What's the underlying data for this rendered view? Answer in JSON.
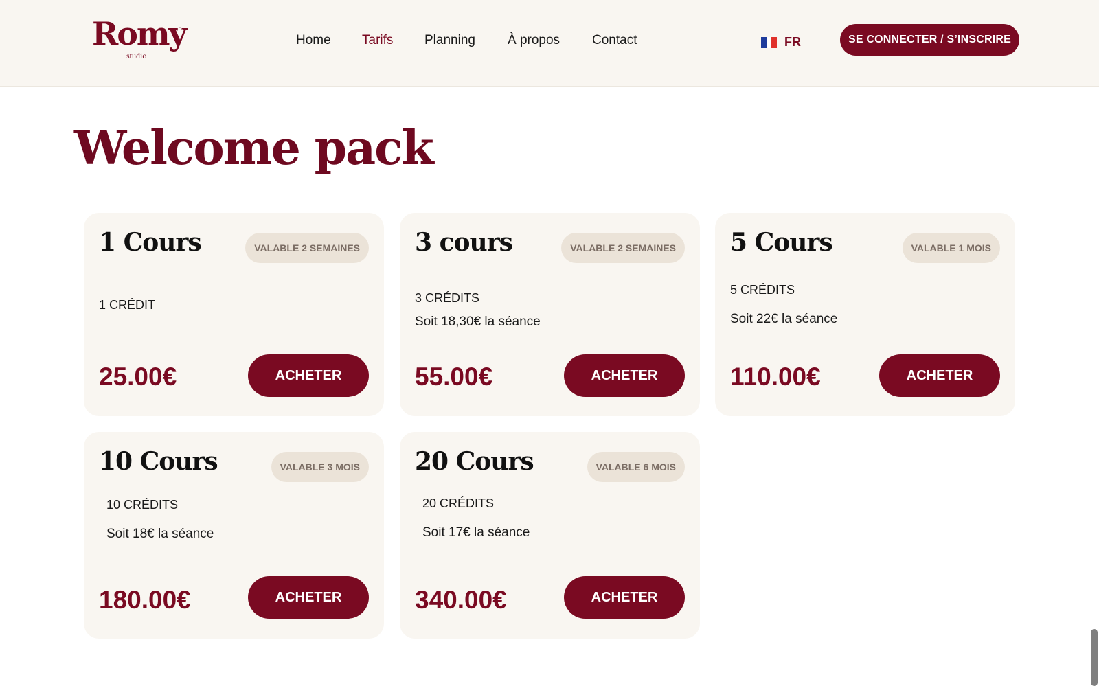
{
  "header": {
    "logo": {
      "name": "Romy",
      "subtitle": "studio"
    },
    "nav": [
      "Home",
      "Tarifs",
      "Planning",
      "À propos",
      "Contact"
    ],
    "active_nav": "Tarifs",
    "language": {
      "code": "FR",
      "flag_colors": [
        "#1f3c9c",
        "#ffffff",
        "#e0312b"
      ]
    },
    "login_label": "SE CONNECTER / S’INSCRIRE"
  },
  "page": {
    "title": "Welcome pack"
  },
  "packs": [
    {
      "title": "1 Cours",
      "validity": "VALABLE 2 SEMAINES",
      "credits": "1 CRÉDIT",
      "per_session": "",
      "price": "25.00€",
      "button": "ACHETER"
    },
    {
      "title": "3 cours",
      "validity": "VALABLE 2 SEMAINES",
      "credits": "3 CRÉDITS",
      "per_session": "Soit 18,30€ la séance",
      "price": "55.00€",
      "button": "ACHETER"
    },
    {
      "title": "5 Cours",
      "validity": "VALABLE 1 MOIS",
      "credits": "5 CRÉDITS",
      "per_session": "Soit 22€ la séance",
      "price": "110.00€",
      "button": "ACHETER"
    },
    {
      "title": "10 Cours",
      "validity": "VALABLE 3 MOIS",
      "credits": "10 CRÉDITS",
      "per_session": "Soit 18€ la séance",
      "price": "180.00€",
      "button": "ACHETER"
    },
    {
      "title": "20 Cours",
      "validity": "VALABLE 6 MOIS",
      "credits": "20 CRÉDITS",
      "per_session": "Soit 17€ la séance",
      "price": "340.00€",
      "button": "ACHETER"
    }
  ],
  "colors": {
    "brand": "#7a0a22",
    "card_bg": "#f9f6f1",
    "badge_bg": "#ebe3d8",
    "header_bg": "#f9f6f1"
  }
}
